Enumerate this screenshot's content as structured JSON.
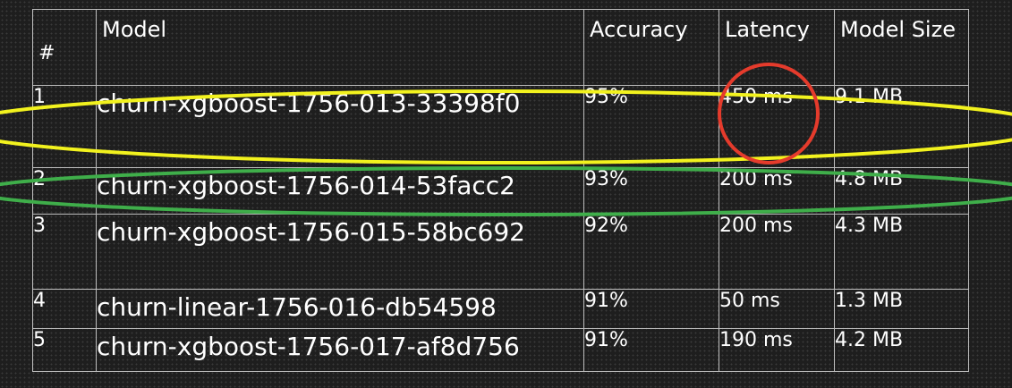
{
  "table": {
    "headers": {
      "num": "#",
      "model": "Model",
      "accuracy": "Accuracy",
      "latency": "Latency",
      "size": "Model Size"
    },
    "rows": [
      {
        "num": "1",
        "model": "churn-xgboost-1756-013-33398f0",
        "accuracy": "95%",
        "latency": "450 ms",
        "size": "9.1 MB"
      },
      {
        "num": "2",
        "model": "churn-xgboost-1756-014-53facc2",
        "accuracy": "93%",
        "latency": "200 ms",
        "size": "4.8 MB"
      },
      {
        "num": "3",
        "model": "churn-xgboost-1756-015-58bc692",
        "accuracy": "92%",
        "latency": "200 ms",
        "size": "4.3 MB"
      },
      {
        "num": "4",
        "model": "churn-linear-1756-016-db54598",
        "accuracy": "91%",
        "latency": "50 ms",
        "size": "1.3 MB"
      },
      {
        "num": "5",
        "model": "churn-xgboost-1756-017-af8d756",
        "accuracy": "91%",
        "latency": "190 ms",
        "size": "4.2 MB"
      }
    ]
  },
  "annotations": {
    "row1_highlight_color": "#f2f21e",
    "row2_highlight_color": "#3fae4a",
    "latency_circle_color": "#e53b2c"
  }
}
